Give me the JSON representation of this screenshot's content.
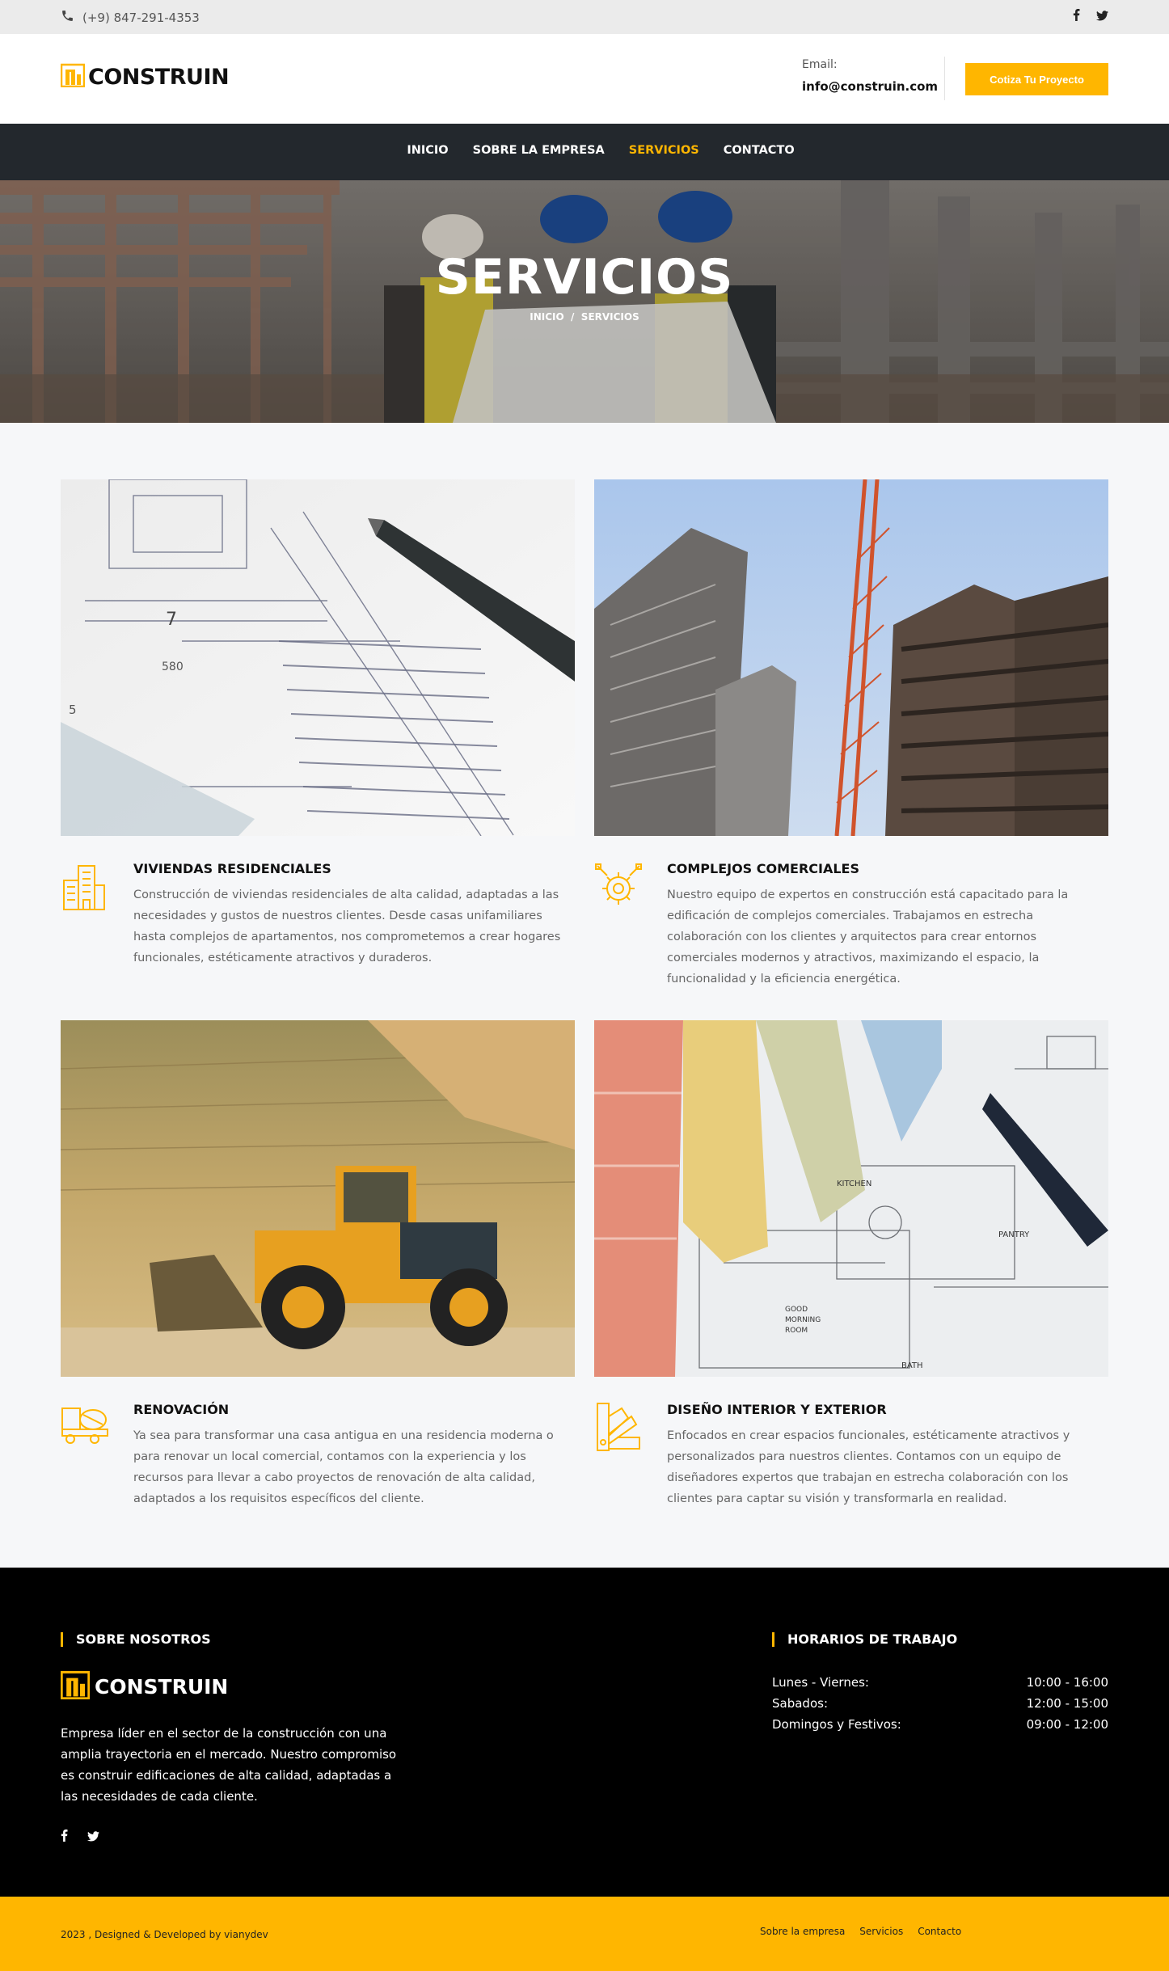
{
  "topbar": {
    "phone": "(+9) 847-291-4353",
    "phone_icon": "phone-icon",
    "social_icons": [
      "facebook-icon",
      "twitter-icon"
    ]
  },
  "header": {
    "logo_text": "CONSTRUIN",
    "email_label": "Email:",
    "email_value": "info@construin.com",
    "cta_label": "Cotiza Tu Proyecto"
  },
  "nav": {
    "items": [
      {
        "label": "INICIO",
        "active": false
      },
      {
        "label": "SOBRE LA EMPRESA",
        "active": false
      },
      {
        "label": "SERVICIOS",
        "active": true
      },
      {
        "label": "CONTACTO",
        "active": false
      }
    ]
  },
  "hero": {
    "title": "SERVICIOS",
    "breadcrumb_home": "INICIO",
    "breadcrumb_sep": "/",
    "breadcrumb_current": "SERVICIOS"
  },
  "services": [
    {
      "title": "VIVIENDAS RESIDENCIALES",
      "description": "Construcción de viviendas residenciales de alta calidad, adaptadas a las necesidades y gustos de nuestros clientes. Desde casas unifamiliares hasta complejos de apartamentos, nos comprometemos a crear hogares funcionales, estéticamente atractivos y duraderos.",
      "icon": "buildings-icon",
      "image": "blueprint-with-pen"
    },
    {
      "title": "COMPLEJOS COMERCIALES",
      "description": "Nuestro equipo de expertos en construcción está capacitado para la edificación de complejos comerciales. Trabajamos en estrecha colaboración con los clientes y arquitectos para crear entornos comerciales modernos y atractivos, maximizando el espacio, la funcionalidad y la eficiencia energética.",
      "icon": "gear-tools-icon",
      "image": "tower-crane-skyscrapers"
    },
    {
      "title": "RENOVACIÓN",
      "description": "Ya sea para transformar una casa antigua en una residencia moderna o para renovar un local comercial, contamos con la experiencia y los recursos para llevar a cabo proyectos de renovación de alta calidad, adaptados a los requisitos específicos del cliente.",
      "icon": "concrete-truck-icon",
      "image": "wheel-loader-quarry"
    },
    {
      "title": "DISEÑO INTERIOR Y EXTERIOR",
      "description": "Enfocados en crear espacios funcionales, estéticamente atractivos y personalizados para nuestros clientes. Contamos con un equipo de diseñadores expertos que trabajan en estrecha colaboración con los clientes para captar su visión y transformarla en realidad.",
      "icon": "color-swatch-icon",
      "image": "color-swatches-floorplan"
    }
  ],
  "image_labels": {
    "blueprint_number_7": "7",
    "blueprint_number_580": "580",
    "blueprint_number_5": "5",
    "floorplan_kitchen": "KITCHEN",
    "floorplan_pantry": "PANTRY",
    "floorplan_room_1": "GOOD",
    "floorplan_room_2": "MORNING",
    "floorplan_room_3": "ROOM",
    "floorplan_bath": "BATH"
  },
  "footer": {
    "about_title": "SOBRE NOSOTROS",
    "logo_text": "CONSTRUIN",
    "about_text": "Empresa líder en el sector de la construcción con una amplia trayectoria en el mercado. Nuestro compromiso es construir edificaciones de alta calidad, adaptadas a las necesidades de cada cliente.",
    "hours_title": "HORARIOS DE TRABAJO",
    "hours": [
      {
        "day": "Lunes - Viernes:",
        "time": "10:00 - 16:00"
      },
      {
        "day": "Sabados:",
        "time": "12:00 - 15:00"
      },
      {
        "day": "Domingos y Festivos:",
        "time": "09:00 - 12:00"
      }
    ],
    "social_icons": [
      "facebook-icon",
      "twitter-icon"
    ]
  },
  "copyright": {
    "text": "2023 , Designed & Developed by",
    "developer": "vianydev",
    "links": [
      "Sobre la empresa",
      "Servicios",
      "Contacto"
    ]
  },
  "colors": {
    "accent": "#ffb600",
    "nav_bg": "#23282d",
    "footer_bg": "#000000",
    "page_bg": "#f6f7f9"
  }
}
